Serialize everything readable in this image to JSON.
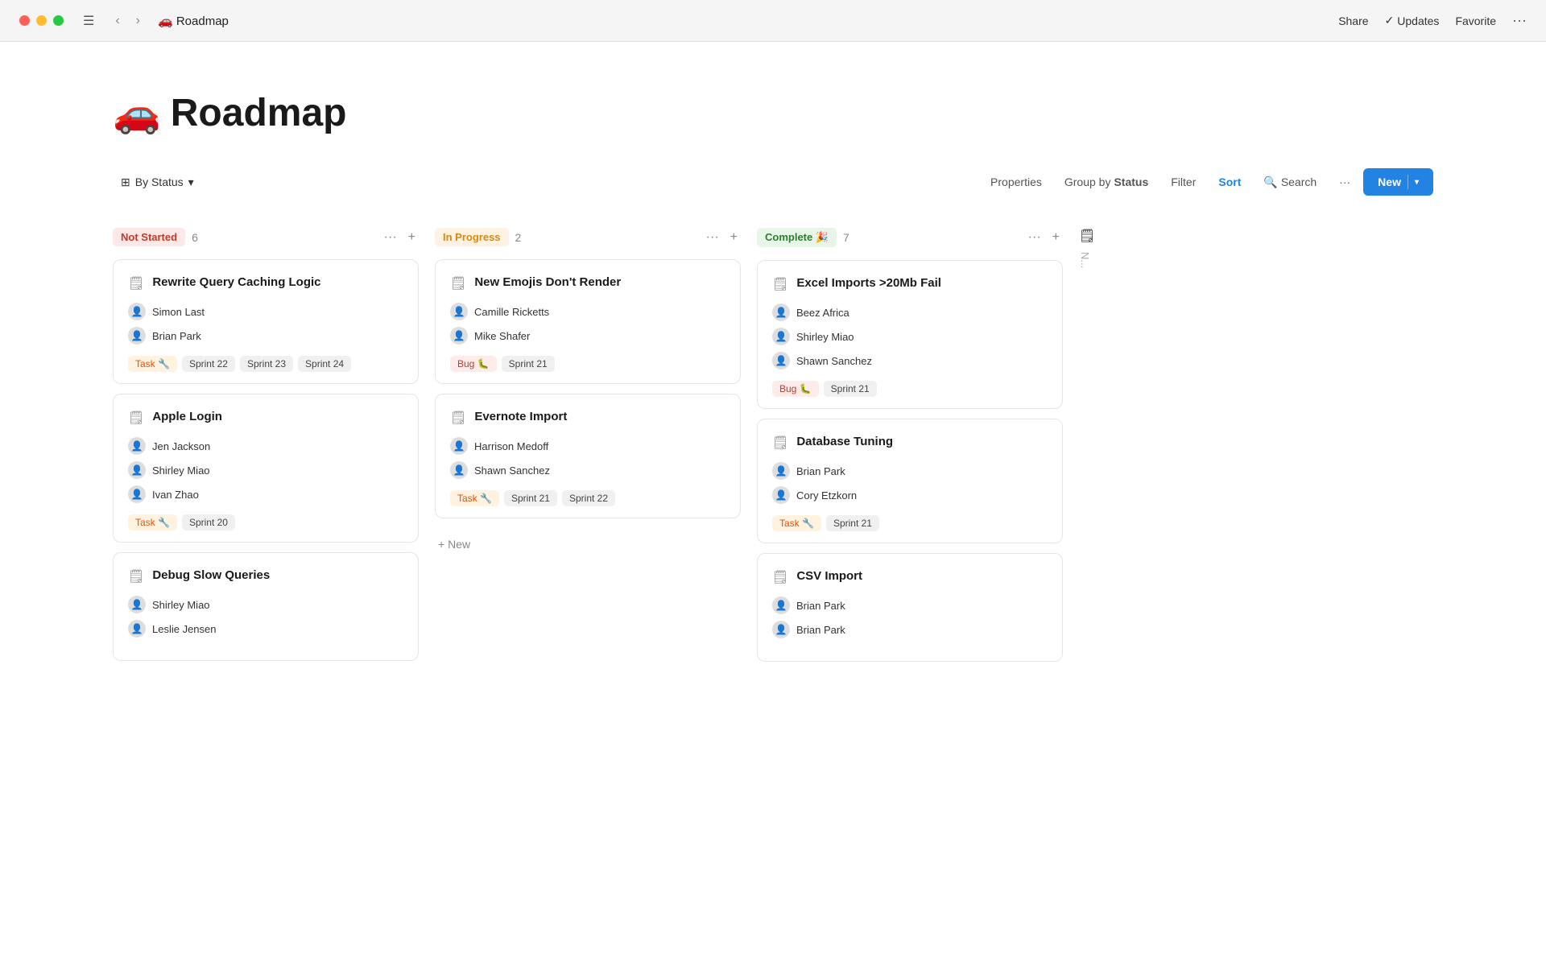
{
  "titlebar": {
    "title": "🚗 Roadmap",
    "actions": {
      "share": "Share",
      "updates": "Updates",
      "favorite": "Favorite",
      "more": "···"
    }
  },
  "page": {
    "emoji": "🚗",
    "title": "Roadmap"
  },
  "toolbar": {
    "group_by_label": "By Status",
    "properties": "Properties",
    "group_by": "Group by",
    "group_by_value": "Status",
    "filter": "Filter",
    "sort": "Sort",
    "search": "Search",
    "more": "···",
    "new_label": "New"
  },
  "columns": [
    {
      "id": "not-started",
      "status": "Not Started",
      "status_type": "not-started",
      "count": 6,
      "cards": [
        {
          "title": "Rewrite Query Caching Logic",
          "assignees": [
            {
              "name": "Simon Last",
              "avatar": "👤"
            },
            {
              "name": "Brian Park",
              "avatar": "👤"
            }
          ],
          "tags": [
            {
              "label": "Task 🔧",
              "type": "task"
            },
            {
              "label": "Sprint 22",
              "type": "sprint"
            },
            {
              "label": "Sprint 23",
              "type": "sprint"
            },
            {
              "label": "Sprint 24",
              "type": "sprint"
            }
          ]
        },
        {
          "title": "Apple Login",
          "assignees": [
            {
              "name": "Jen Jackson",
              "avatar": "👤"
            },
            {
              "name": "Shirley Miao",
              "avatar": "👤"
            },
            {
              "name": "Ivan Zhao",
              "avatar": "👤"
            }
          ],
          "tags": [
            {
              "label": "Task 🔧",
              "type": "task"
            },
            {
              "label": "Sprint 20",
              "type": "sprint"
            }
          ]
        },
        {
          "title": "Debug Slow Queries",
          "assignees": [
            {
              "name": "Shirley Miao",
              "avatar": "👤"
            },
            {
              "name": "Leslie Jensen",
              "avatar": "👤"
            }
          ],
          "tags": []
        }
      ]
    },
    {
      "id": "in-progress",
      "status": "In Progress",
      "status_type": "in-progress",
      "count": 2,
      "cards": [
        {
          "title": "New Emojis Don't Render",
          "assignees": [
            {
              "name": "Camille Ricketts",
              "avatar": "👤"
            },
            {
              "name": "Mike Shafer",
              "avatar": "👤"
            }
          ],
          "tags": [
            {
              "label": "Bug 🐛",
              "type": "bug"
            },
            {
              "label": "Sprint 21",
              "type": "sprint"
            }
          ]
        },
        {
          "title": "Evernote Import",
          "assignees": [
            {
              "name": "Harrison Medoff",
              "avatar": "👤"
            },
            {
              "name": "Shawn Sanchez",
              "avatar": "👤"
            }
          ],
          "tags": [
            {
              "label": "Task 🔧",
              "type": "task"
            },
            {
              "label": "Sprint 21",
              "type": "sprint"
            },
            {
              "label": "Sprint 22",
              "type": "sprint"
            }
          ]
        }
      ],
      "new_card_label": "+ New"
    },
    {
      "id": "complete",
      "status": "Complete 🎉",
      "status_type": "complete",
      "count": 7,
      "cards": [
        {
          "title": "Excel Imports >20Mb Fail",
          "assignees": [
            {
              "name": "Beez Africa",
              "avatar": "👤"
            },
            {
              "name": "Shirley Miao",
              "avatar": "👤"
            },
            {
              "name": "Shawn Sanchez",
              "avatar": "👤"
            }
          ],
          "tags": [
            {
              "label": "Bug 🐛",
              "type": "bug"
            },
            {
              "label": "Sprint 21",
              "type": "sprint"
            }
          ]
        },
        {
          "title": "Database Tuning",
          "assignees": [
            {
              "name": "Brian Park",
              "avatar": "👤"
            },
            {
              "name": "Cory Etzkorn",
              "avatar": "👤"
            }
          ],
          "tags": [
            {
              "label": "Task 🔧",
              "type": "task"
            },
            {
              "label": "Sprint 21",
              "type": "sprint"
            }
          ]
        },
        {
          "title": "CSV Import",
          "assignees": [
            {
              "name": "Brian Park",
              "avatar": "👤"
            },
            {
              "name": "Brian Park",
              "avatar": "👤"
            }
          ],
          "tags": []
        }
      ]
    }
  ],
  "hidden_column": {
    "label": "N..."
  }
}
